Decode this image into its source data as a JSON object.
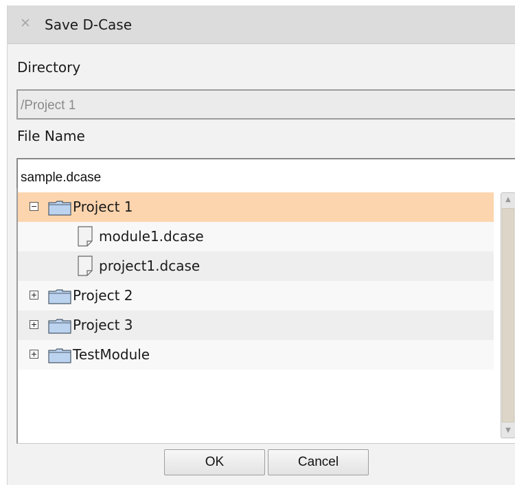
{
  "dialog": {
    "title": "Save D-Case",
    "close_icon": "close-icon"
  },
  "directory": {
    "label": "Directory",
    "value": "/Project 1"
  },
  "file_name": {
    "label": "File Name",
    "value": "sample.dcase"
  },
  "tree": {
    "items": [
      {
        "label": "Project 1",
        "type": "folder",
        "expanded": true,
        "selected": true,
        "icon": "folder-icon"
      },
      {
        "label": "module1.dcase",
        "type": "file",
        "icon": "file-icon"
      },
      {
        "label": "project1.dcase",
        "type": "file",
        "icon": "file-icon"
      },
      {
        "label": "Project 2",
        "type": "folder",
        "expanded": false,
        "icon": "folder-icon"
      },
      {
        "label": "Project 3",
        "type": "folder",
        "expanded": false,
        "icon": "folder-icon"
      },
      {
        "label": "TestModule",
        "type": "folder",
        "expanded": false,
        "icon": "folder-icon"
      }
    ]
  },
  "buttons": {
    "ok_label": "OK",
    "cancel_label": "Cancel"
  },
  "colors": {
    "selected_row": "#fcd5ae",
    "folder": "#bcd3f0"
  }
}
